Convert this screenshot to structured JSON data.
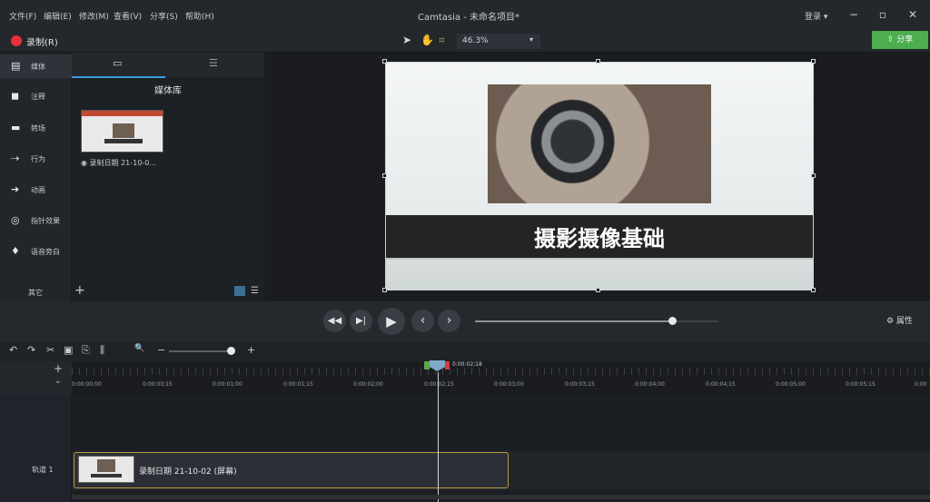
{
  "titlebar": {
    "menus": [
      "文件(F)",
      "编辑(E)",
      "修改(M)",
      "查看(V)",
      "分享(S)",
      "帮助(H)"
    ],
    "app_title": "Camtasia - 未命名项目*",
    "login": "登录 ▾",
    "minimize": "−",
    "maximize": "▫",
    "close": "✕"
  },
  "toolbar": {
    "record_label": "录制(R)",
    "zoom_value": "46.3%",
    "share_label": "⇧ 分享"
  },
  "sidebar": {
    "items": [
      {
        "icon": "▤",
        "label": "媒体"
      },
      {
        "icon": "◼",
        "label": "注释"
      },
      {
        "icon": "▬",
        "label": "转场"
      },
      {
        "icon": "⇢",
        "label": "行为"
      },
      {
        "icon": "➔",
        "label": "动画"
      },
      {
        "icon": "◎",
        "label": "指针效果"
      },
      {
        "icon": "♦",
        "label": "语音旁白"
      }
    ],
    "more_label": "其它"
  },
  "media": {
    "tab_media_icon": "▭",
    "tab_list_icon": "☰",
    "library_title": "媒体库",
    "thumb_caption": "◉ 录制日期 21-10-0...",
    "add_icon": "+"
  },
  "canvas": {
    "slide_title": "摄影摄像基础"
  },
  "playback": {
    "prev": "◀◀",
    "step": "▶|",
    "play": "▶",
    "back": "‹",
    "forward": "›",
    "properties_label": "⚙ 属性",
    "progress": 0.81
  },
  "timeline": {
    "tools": [
      "↶",
      "↷",
      "✂",
      "▣",
      "⎘",
      "⫼",
      "🔍",
      "−",
      "+"
    ],
    "playhead_time": "0:00:02;18",
    "ticks": [
      "0:00:00;00",
      "0:00:00;15",
      "0:00:01;00",
      "0:00:01;15",
      "0:00:02;00",
      "0:00:02;15",
      "0:00:03;00",
      "0:00:03;15",
      "0:00:04;00",
      "0:00:04;15",
      "0:00:05;00",
      "0:00:05;15",
      "0:00"
    ],
    "track_label": "轨道 1",
    "clip_label": "录制日期 21-10-02 (屏幕)"
  }
}
